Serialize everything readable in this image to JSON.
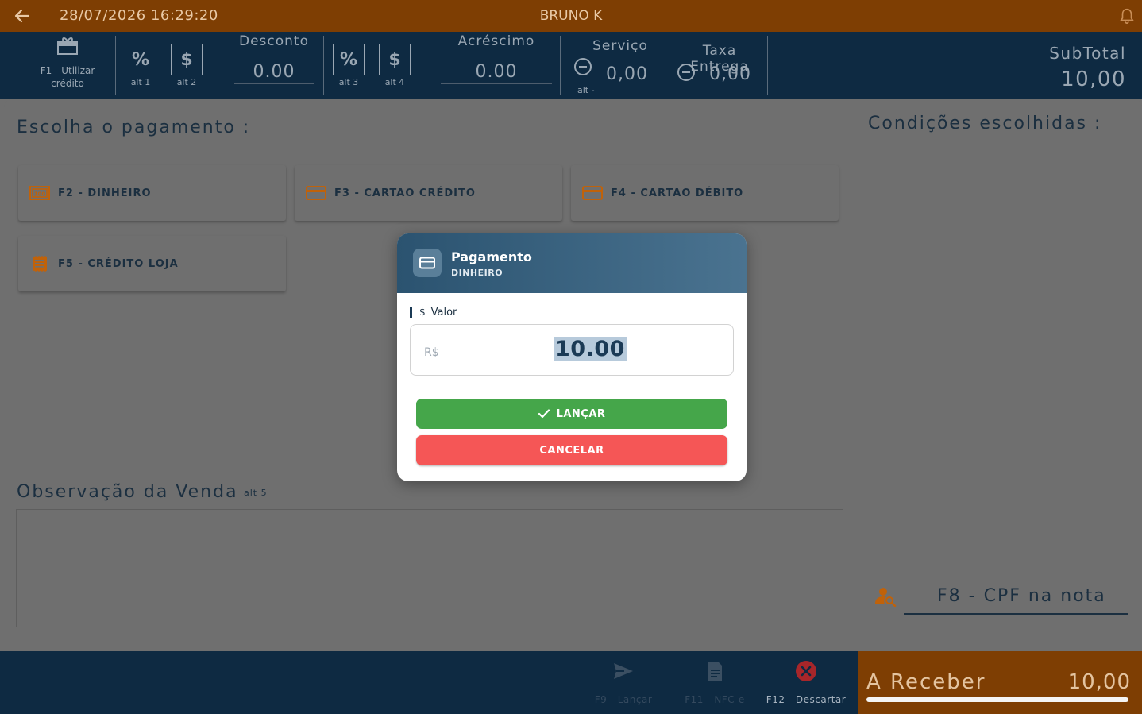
{
  "topbar": {
    "datetime": "28/07/2026 16:29:20",
    "user": "BRUNO K"
  },
  "header": {
    "f1_label": "F1 -  Utilizar crédito",
    "desc_percent": "%",
    "desc_dollar": "$",
    "alt1": "alt 1",
    "alt2": "alt 2",
    "desconto_title": "Desconto",
    "desconto_value": "0.00",
    "acr_percent": "%",
    "acr_dollar": "$",
    "alt3": "alt 3",
    "alt4": "alt 4",
    "acrescimo_title": "Acréscimo",
    "acrescimo_value": "0.00",
    "servico_title": "Serviço",
    "servico_value": "0,00",
    "alt_minus": "alt -",
    "taxa_title": "Taxa Entrega",
    "taxa_value": "0,00",
    "subtotal_label": "SubTotal",
    "subtotal_value": "10,00"
  },
  "main": {
    "escolha_title": "Escolha o pagamento :",
    "condicoes_title": "Condições escolhidas :",
    "payment_options": [
      {
        "label": "F2 - DINHEIRO",
        "icon": "cash-icon"
      },
      {
        "label": "F3 - CARTAO CRÉDITO",
        "icon": "credit-card-icon"
      },
      {
        "label": "F4 - CARTAO DÉBITO",
        "icon": "debit-card-icon"
      },
      {
        "label": "F5 - CRÉDITO LOJA",
        "icon": "receipt-icon"
      }
    ],
    "obs_title": "Observação da Venda",
    "obs_alt": "alt 5",
    "cpf_placeholder": "F8 - CPF na nota"
  },
  "bottom": {
    "lancar": "F9 - Lançar",
    "nfce": "F11 - NFC-e",
    "descartar": "F12 - Descartar",
    "areceber_label": "A Receber",
    "areceber_value": "10,00"
  },
  "modal": {
    "title": "Pagamento",
    "subtitle": "DINHEIRO",
    "field_symbol": "$",
    "field_label": "Valor",
    "currency": "R$",
    "amount": "10.00",
    "confirm": "LANÇAR",
    "cancel": "CANCELAR"
  },
  "colors": {
    "orange": "#7e3e03",
    "navy": "#0e2a42",
    "confirm_green": "#45a64a",
    "cancel_red": "#f55656",
    "overlay_gray": "#6f6f6f"
  }
}
